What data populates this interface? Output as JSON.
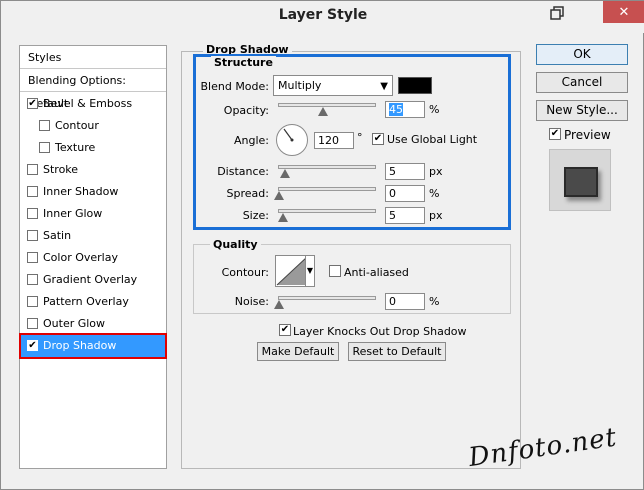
{
  "window": {
    "title": "Layer Style",
    "close_glyph": "✕"
  },
  "styles_panel": {
    "header": "Styles",
    "blending_options": "Blending Options: Default",
    "items": [
      {
        "label": "Bevel & Emboss",
        "checked": true,
        "indent": false
      },
      {
        "label": "Contour",
        "checked": false,
        "indent": true
      },
      {
        "label": "Texture",
        "checked": false,
        "indent": true
      },
      {
        "label": "Stroke",
        "checked": false,
        "indent": false
      },
      {
        "label": "Inner Shadow",
        "checked": false,
        "indent": false
      },
      {
        "label": "Inner Glow",
        "checked": false,
        "indent": false
      },
      {
        "label": "Satin",
        "checked": false,
        "indent": false
      },
      {
        "label": "Color Overlay",
        "checked": false,
        "indent": false
      },
      {
        "label": "Gradient Overlay",
        "checked": false,
        "indent": false
      },
      {
        "label": "Pattern Overlay",
        "checked": false,
        "indent": false
      },
      {
        "label": "Outer Glow",
        "checked": false,
        "indent": false
      },
      {
        "label": "Drop Shadow",
        "checked": true,
        "indent": false,
        "selected": true
      }
    ]
  },
  "drop_shadow": {
    "title": "Drop Shadow",
    "structure": {
      "title": "Structure",
      "blend_mode_label": "Blend Mode:",
      "blend_mode_value": "Multiply",
      "shadow_color": "#000000",
      "opacity_label": "Opacity:",
      "opacity_value": "45",
      "opacity_unit": "%",
      "angle_label": "Angle:",
      "angle_value": "120",
      "angle_unit": "°",
      "use_global_light_label": "Use Global Light",
      "use_global_light": true,
      "distance_label": "Distance:",
      "distance_value": "5",
      "distance_unit": "px",
      "spread_label": "Spread:",
      "spread_value": "0",
      "spread_unit": "%",
      "size_label": "Size:",
      "size_value": "5",
      "size_unit": "px"
    },
    "quality": {
      "title": "Quality",
      "contour_label": "Contour:",
      "anti_aliased_label": "Anti-aliased",
      "anti_aliased": false,
      "noise_label": "Noise:",
      "noise_value": "0",
      "noise_unit": "%"
    },
    "knocks_out_label": "Layer Knocks Out Drop Shadow",
    "knocks_out": true,
    "make_default_label": "Make Default",
    "reset_default_label": "Reset to Default"
  },
  "actions": {
    "ok_label": "OK",
    "cancel_label": "Cancel",
    "new_style_label": "New Style...",
    "preview_label": "Preview",
    "preview_checked": true
  },
  "watermark": "Dnfoto.net"
}
